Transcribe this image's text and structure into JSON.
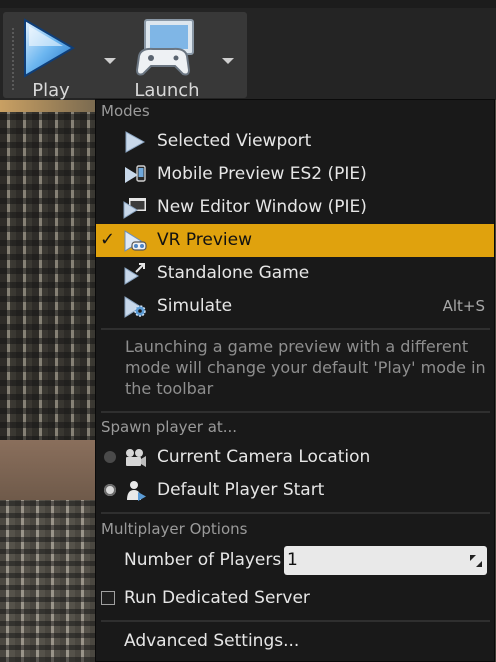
{
  "toolbar": {
    "play_label": "Play",
    "launch_label": "Launch"
  },
  "menu": {
    "modes_header": "Modes",
    "items": [
      {
        "label": "Selected Viewport",
        "shortcut": "",
        "selected": false,
        "icon": "play-triangle-icon"
      },
      {
        "label": "Mobile Preview ES2 (PIE)",
        "shortcut": "",
        "selected": false,
        "icon": "mobile-preview-icon"
      },
      {
        "label": "New Editor Window (PIE)",
        "shortcut": "",
        "selected": false,
        "icon": "editor-window-icon"
      },
      {
        "label": "VR Preview",
        "shortcut": "",
        "selected": true,
        "icon": "vr-headset-icon"
      },
      {
        "label": "Standalone Game",
        "shortcut": "",
        "selected": false,
        "icon": "standalone-game-icon"
      },
      {
        "label": "Simulate",
        "shortcut": "Alt+S",
        "selected": false,
        "icon": "simulate-gear-icon"
      }
    ],
    "description": "Launching a game preview with a different mode will change your default 'Play' mode in the toolbar",
    "spawn_header": "Spawn player at...",
    "spawn_options": [
      {
        "label": "Current Camera Location",
        "selected": false,
        "icon": "camera-icon"
      },
      {
        "label": "Default Player Start",
        "selected": true,
        "icon": "player-start-icon"
      }
    ],
    "multiplayer_header": "Multiplayer Options",
    "number_of_players_label": "Number of Players",
    "number_of_players_value": "1",
    "dedicated_server_label": "Run Dedicated Server",
    "dedicated_server_checked": false,
    "advanced_settings_label": "Advanced Settings..."
  },
  "colors": {
    "accent": "#e0a20d",
    "menu_bg": "#191919",
    "toolbar_bg": "#383838"
  }
}
